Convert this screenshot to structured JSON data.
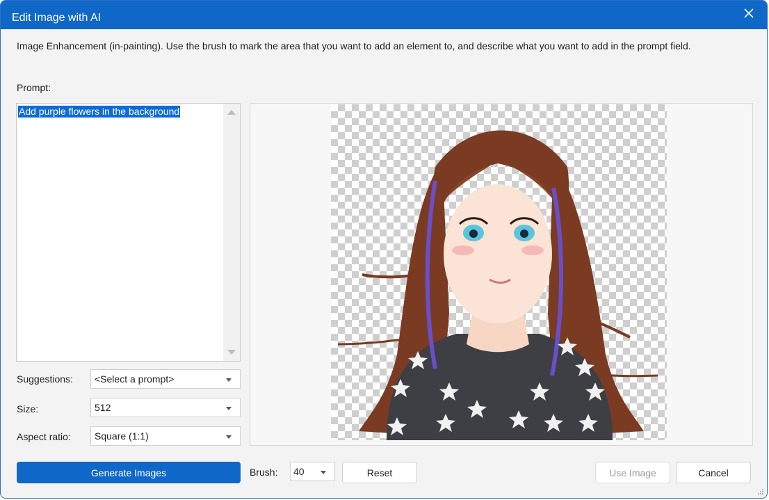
{
  "window": {
    "title": "Edit Image with AI"
  },
  "description": "Image Enhancement (in-painting). Use the brush to mark the area that you want to add an element to, and describe what you want to add in the prompt field.",
  "prompt": {
    "label": "Prompt:",
    "value": "Add purple flowers in the background"
  },
  "suggestions": {
    "label": "Suggestions:",
    "value": "<Select a prompt>"
  },
  "size": {
    "label": "Size:",
    "value": "512"
  },
  "aspect_ratio": {
    "label": "Aspect ratio:",
    "value": "Square (1:1)"
  },
  "buttons": {
    "generate": "Generate Images",
    "reset": "Reset",
    "use_image": "Use Image",
    "cancel": "Cancel"
  },
  "brush": {
    "label": "Brush:",
    "value": "40"
  },
  "icons": {
    "close": "close-icon",
    "resize": "resize-grip-icon"
  },
  "colors": {
    "accent": "#0f68c8",
    "selection": "#0f6bd7"
  }
}
